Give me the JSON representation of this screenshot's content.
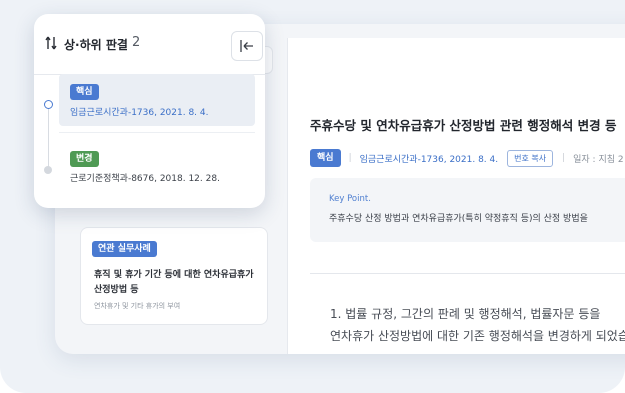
{
  "related_panel": {
    "title": "상·하위 판결",
    "count": "2",
    "items": [
      {
        "badge": "핵심",
        "badge_color": "#4a7ad1",
        "ref": "임금근로시간과-1736, 2021. 8. 4.",
        "active": true
      },
      {
        "badge": "변경",
        "badge_color": "#4f9a54",
        "ref": "근로기준정책과-8676, 2018. 12. 28.",
        "active": false
      }
    ]
  },
  "case_card": {
    "badge": "연관 실무사례",
    "title": "휴직 및 휴가 기간 등에 대한 연차유급휴가 산정방법 등",
    "tags": "연차휴가 및 기타 휴가의 부여"
  },
  "document": {
    "title": "주휴수당 및 연차유급휴가 산정방법 관련 행정해석 변경 등",
    "badge": "핵심",
    "ref": "임금근로시간과-1736, 2021. 8. 4.",
    "copy_label": "번호 복사",
    "date_label": "일자 : 지침 2",
    "keypoint_label": "Key Point.",
    "keypoint_text": "주휴수당 산정 방법과 연차유급휴가(특히 약정휴직 등)의 산정 방법을",
    "body_line1": "1.  법률 규정, 그간의 판례 및 행정해석, 법률자문 등을",
    "body_line2": "연차휴가 산정방법에 대한 기존 행정해석을 변경하게 되었습"
  },
  "colors": {
    "accent": "#4a7ad1",
    "change": "#4f9a54",
    "link": "#3b6fc7"
  },
  "icons": [
    "sort-icon",
    "collapse-panel-icon"
  ]
}
